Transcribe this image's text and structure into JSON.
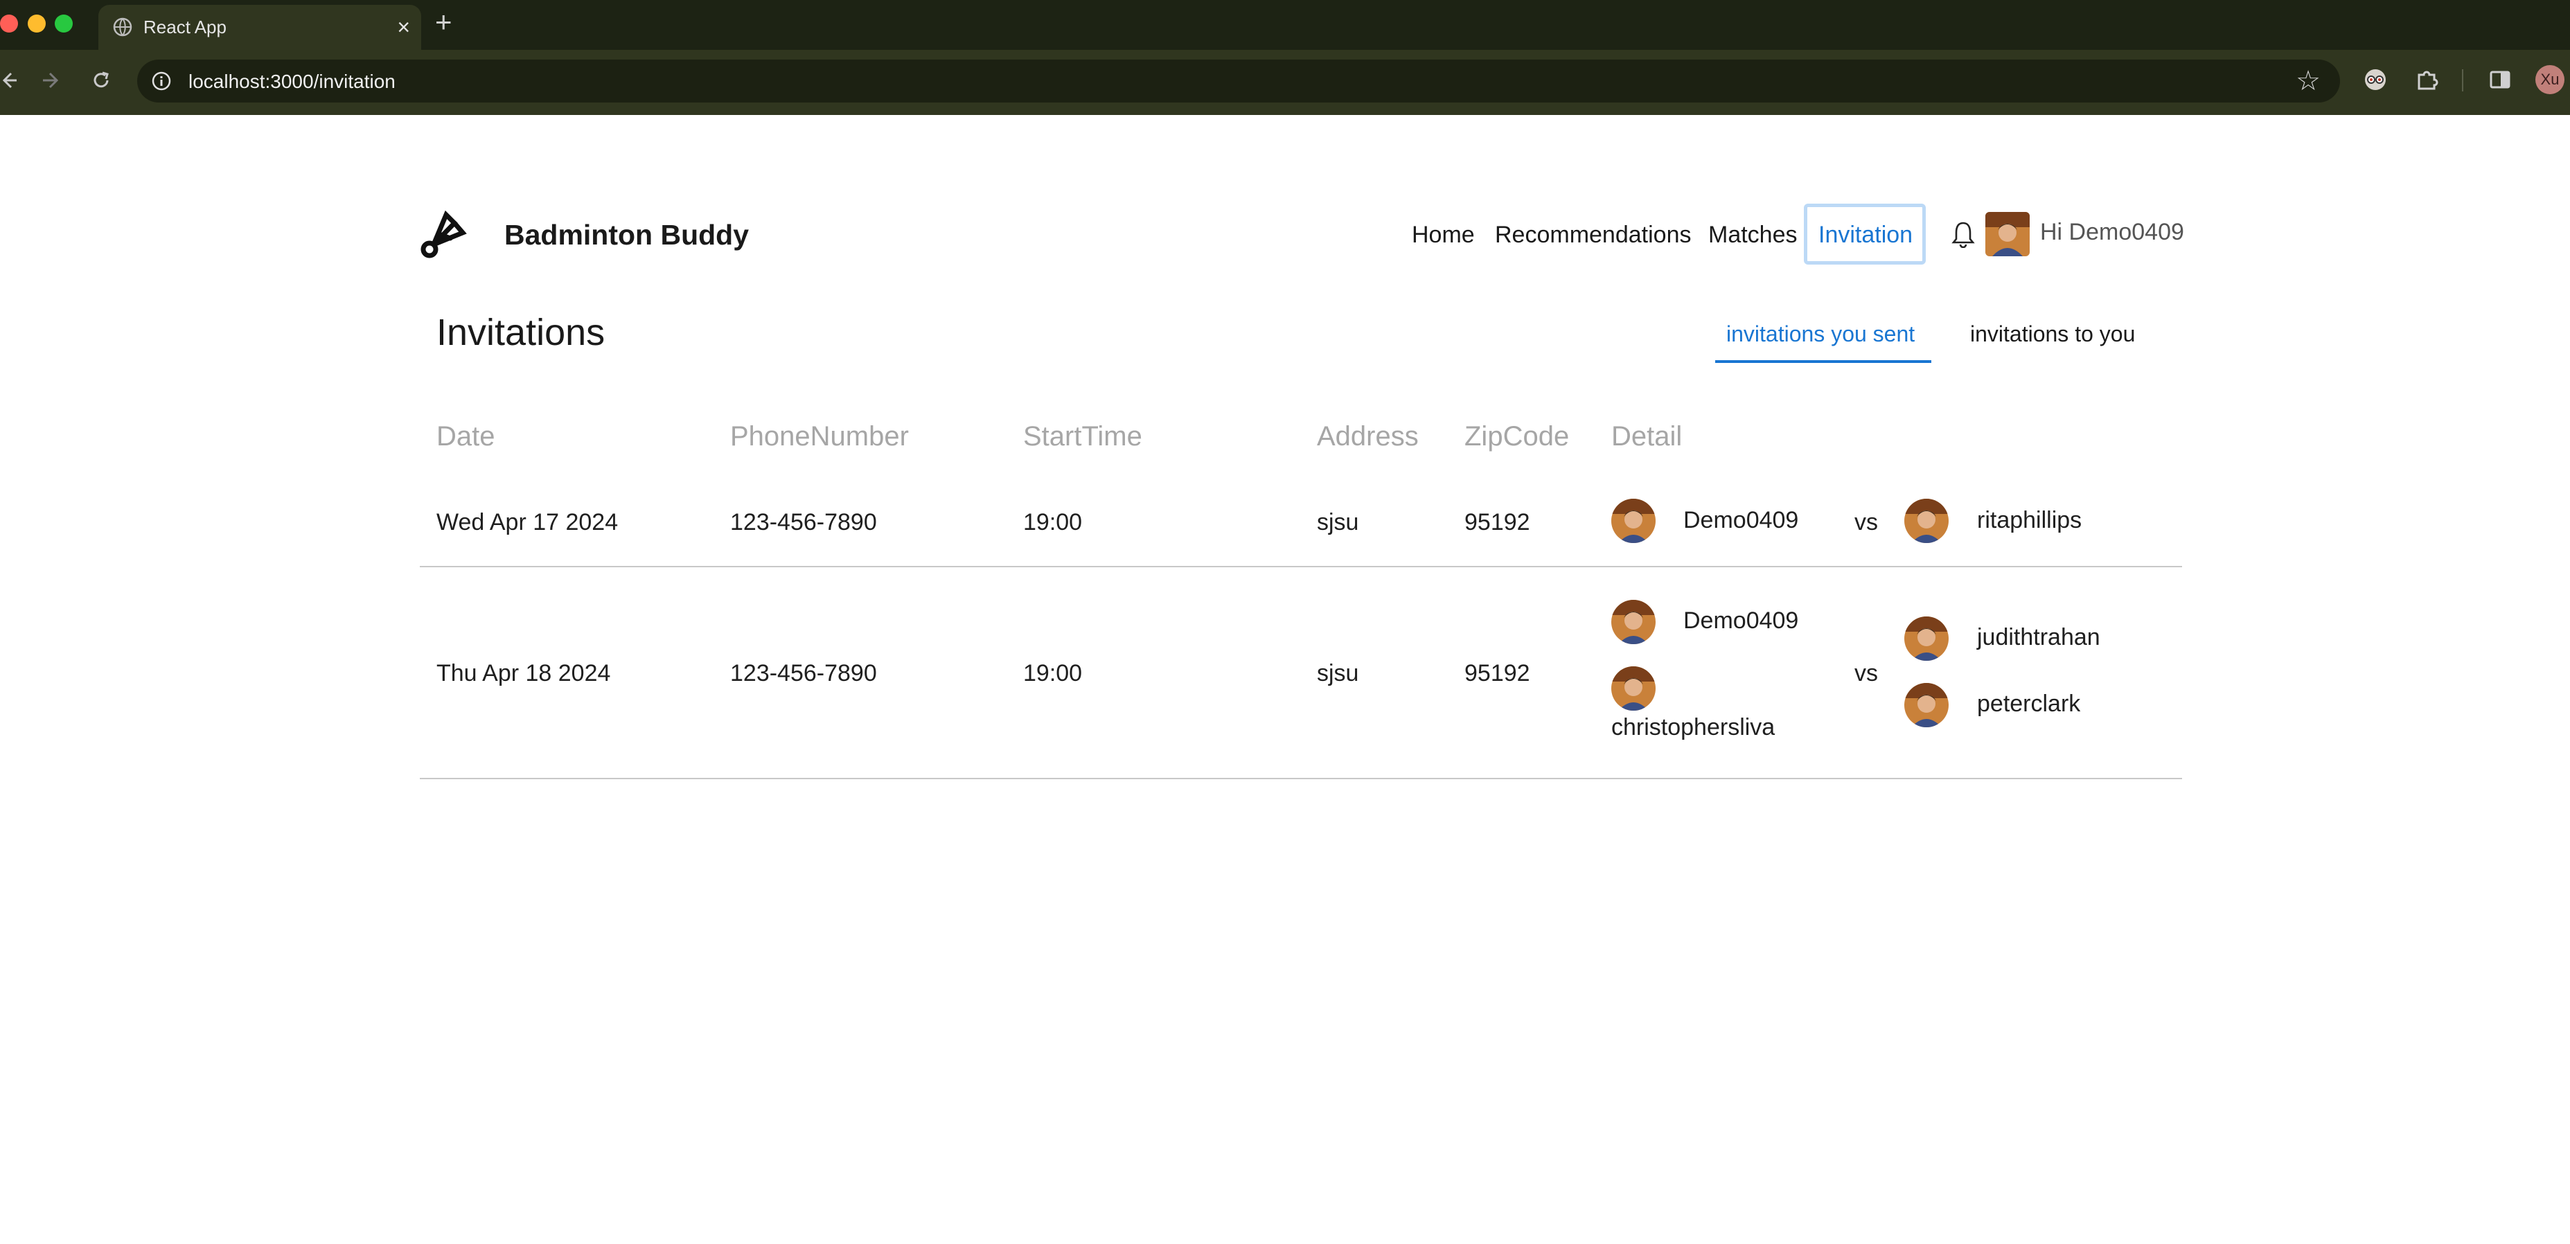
{
  "browser": {
    "tab_title": "React App",
    "tab_close": "×",
    "new_tab": "+",
    "url": "localhost:3000/invitation",
    "profile_initials": "Xu"
  },
  "header": {
    "brand": "Badminton Buddy",
    "nav": [
      "Home",
      "Recommendations",
      "Matches",
      "Invitation"
    ],
    "active_nav": "Invitation",
    "greeting": "Hi Demo0409"
  },
  "section": {
    "title": "Invitations",
    "tabs": [
      "invitations you sent",
      "invitations to you"
    ],
    "active_tab": "invitations you sent"
  },
  "table": {
    "columns": [
      "Date",
      "PhoneNumber",
      "StartTime",
      "Address",
      "ZipCode",
      "Detail"
    ],
    "vs_label": "vs",
    "rows": [
      {
        "date": "Wed Apr 17 2024",
        "phone": "123-456-7890",
        "start": "19:00",
        "address": "sjsu",
        "zip": "95192",
        "team_a": [
          "Demo0409"
        ],
        "team_b": [
          "ritaphillips"
        ]
      },
      {
        "date": "Thu Apr 18 2024",
        "phone": "123-456-7890",
        "start": "19:00",
        "address": "sjsu",
        "zip": "95192",
        "team_a": [
          "Demo0409",
          "christophersliva"
        ],
        "team_b": [
          "judithtrahan",
          "peterclark"
        ]
      }
    ]
  },
  "colors": {
    "accent": "#1976d2",
    "active_outline": "#bcd9f6",
    "header_muted": "#a6a6a6",
    "chrome_dark": "#1d2314"
  }
}
